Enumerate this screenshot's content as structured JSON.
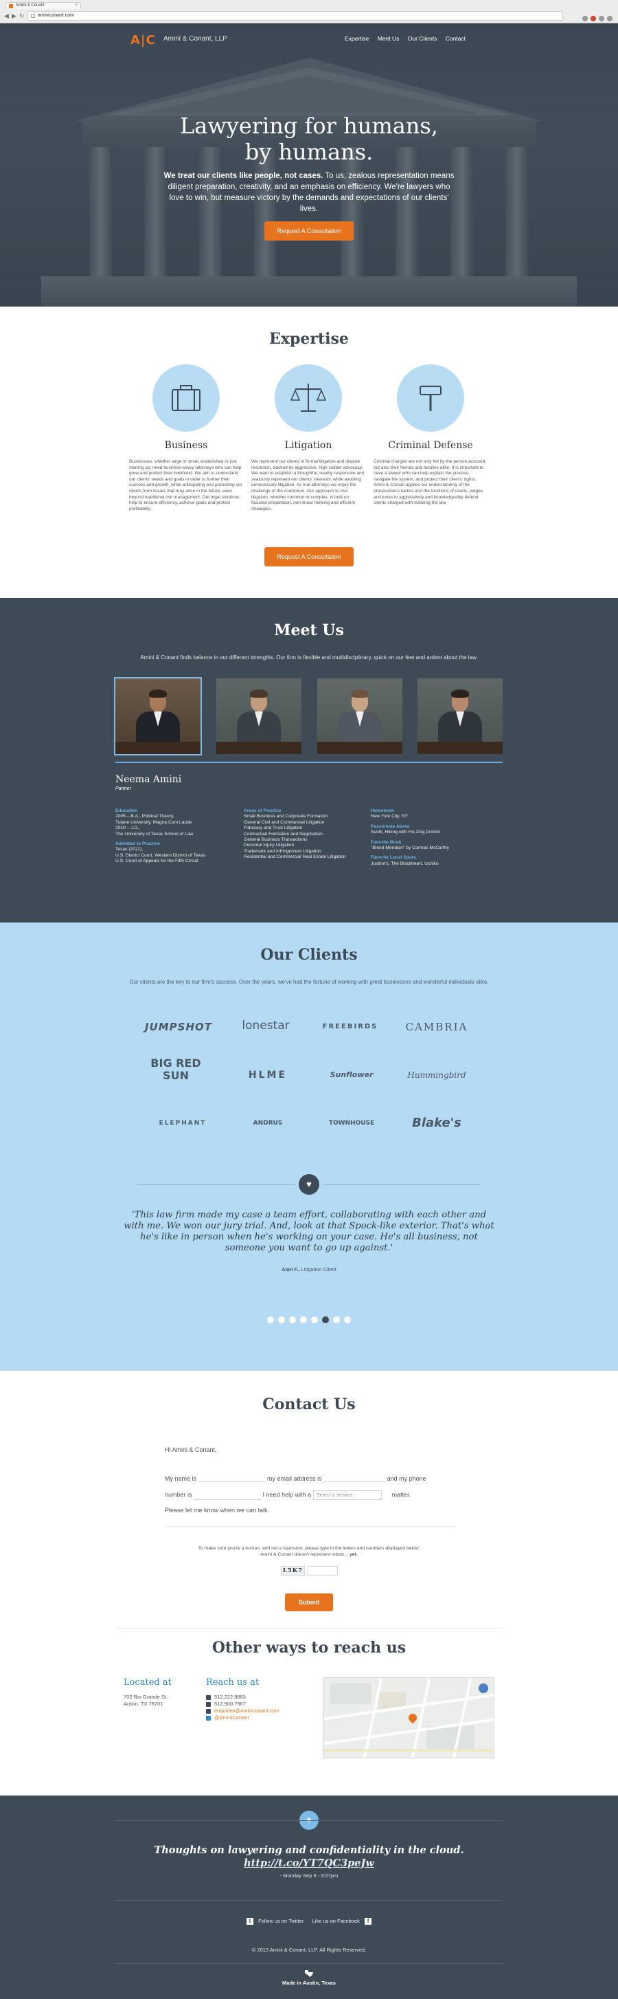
{
  "browser": {
    "tab_title": "Amini & Conant",
    "url": "aminiconant.com"
  },
  "header": {
    "logo": "A|C",
    "firm_name": "Amini & Conant, LLP",
    "nav": [
      "Expertise",
      "Meet Us",
      "Our Clients",
      "Contact"
    ]
  },
  "hero": {
    "title_line1": "Lawyering for humans,",
    "title_line2": "by humans.",
    "lede_bold": "We treat our clients like people, not cases.",
    "lede_rest": " To us, zealous representation means diligent preparation, creativity, and an emphasis on efficiency. We're lawyers who love to win, but measure victory by the demands and expectations of our clients' lives.",
    "cta": "Request A Consultation"
  },
  "expertise": {
    "title": "Expertise",
    "items": [
      {
        "icon": "briefcase-icon",
        "title": "Business",
        "text": "Businesses, whether large or small, established or just starting up, need business-savvy attorneys who can help grow and protect their livelihood. We aim to understand our clients' needs and goals in order to further their success and growth, while anticipating and protecting our clients from issues that may arise in the future, even beyond traditional risk management. Our legal solutions help to ensure efficiency, achieve goals and protect profitability."
      },
      {
        "icon": "scales-icon",
        "title": "Litigation",
        "text": "We represent our clients in formal litigation and dispute resolution, backed by aggressive, high-caliber advocacy. We want to establish a thoughtful, readily responsive and zealously represent our clients' interests, while avoiding unnecessary litigation. As trial attorneys we enjoy the challenge of the courtroom. Our approach to civil litigation, whether common or complex, is built on focused preparation, non-linear thinking and efficient strategies."
      },
      {
        "icon": "gavel-icon",
        "title": "Criminal Defense",
        "text": "Criminal charges are not only felt by the person accused, but also their friends and families alike. It is important to have a lawyer who can help explain the process, navigate the system, and protect their clients' rights. Amini & Conant applies our understanding of the prosecution's tactics and the functions of courts, judges and juries to aggressively and knowledgeably defend clients charged with violating the law."
      }
    ],
    "cta": "Request A Consultation"
  },
  "meet": {
    "title": "Meet Us",
    "intro": "Amini & Conant finds balance in our different strengths. Our firm is flexible and multidisciplinary, quick on our feet and ardent about the law.",
    "people_count_label": "4",
    "person": {
      "name": "Neema Amini",
      "role": "Partner",
      "col1": [
        {
          "h": "Education"
        },
        {
          "t": "2005 – B.A., Political Theory,"
        },
        {
          "t": "Tulane University, Magna Cum Laude"
        },
        {
          "t": "2010 – J.D.,"
        },
        {
          "t": "The University of Texas School of Law"
        },
        {
          "gap": true
        },
        {
          "h": "Admitted to Practice"
        },
        {
          "t": "Texas (2011),"
        },
        {
          "t": "U.S. District Court, Western District of Texas"
        },
        {
          "t": "U.S. Court of Appeals for the Fifth Circuit"
        }
      ],
      "col2": [
        {
          "h": "Areas of Practice"
        },
        {
          "t": "Small Business and Corporate Formation"
        },
        {
          "t": "General Civil and Commercial Litigation"
        },
        {
          "t": "Fiduciary and Trust Litigation"
        },
        {
          "t": "Contractual Formation and Negotiation"
        },
        {
          "t": "General Business Transactions"
        },
        {
          "t": "Personal Injury Litigation"
        },
        {
          "t": "Trademark and Infringement Litigation"
        },
        {
          "t": "Residential and Commercial Real Estate Litigation"
        }
      ],
      "col3": [
        {
          "h": "Hometown"
        },
        {
          "t": "New York City, NY"
        },
        {
          "gap": true
        },
        {
          "h": "Passionate About"
        },
        {
          "t": "Sushi, Hiking with His Dog Drinkin"
        },
        {
          "gap": true
        },
        {
          "h": "Favorite Book"
        },
        {
          "t": "\"Blood Meridian\" by Cormac McCarthy"
        },
        {
          "gap": true
        },
        {
          "h": "Favorite Local Spots"
        },
        {
          "t": "Justine's, The Blackheart, Uchiko"
        }
      ]
    }
  },
  "clients": {
    "title": "Our Clients",
    "intro": "Our clients are the key to our firm's success. Over the years, we've had the fortune of working with great businesses and wonderful individuals alike.",
    "logos": [
      "JUMPSHOT",
      "lonestar",
      "FREEBIRDS",
      "CAMBRIA",
      "BIG RED SUN",
      "HLME",
      "Sunflower",
      "Hummingbird",
      "ELEPHANT",
      "ANDRUS",
      "TOWNHOUSE",
      "Blake's"
    ],
    "quote": "'This law firm made my case a team effort, collaborating with each other and with me. We won our jury trial. And, look at that Spock-like exterior. That's what he's like in person when he's working on your case. He's all business, not someone you want to go up against.'",
    "cite_name": "Alan F.,",
    "cite_role": " Litigation Client",
    "slides": 8,
    "active_slide": 5
  },
  "contact": {
    "title": "Contact Us",
    "greeting": "Hi Amini & Conant,",
    "my_name_is": "My name is",
    "my_email_is": "my email address is",
    "and_my_phone": "and my phone",
    "number_is": "number is",
    "need_help": "I need help with a",
    "select_placeholder": "Select a service",
    "matter": "matter.",
    "closing": "Please let me know when we can talk.",
    "captcha_note1": "To make sure you're a human, and not a spam-bot, please type in the letters and numbers displayed below.",
    "captcha_note2": "Amini & Conant doesn't represent robots...",
    "captcha_note_bold": "yet.",
    "captcha_code": "L5K7",
    "submit": "Submit",
    "other_title": "Other ways to reach us",
    "located_h": "Located at",
    "address1": "702 Rio Grande St.",
    "address2": "Austin, TX 78701",
    "reach_h": "Reach us at",
    "phone": "512.222.8883",
    "fax": "512.900.7967",
    "email": "enquiries@aminiconant.com",
    "twitter": "@AminiConant"
  },
  "footer": {
    "tweet": "Thoughts on lawyering and confidentiality in the cloud.",
    "tweet_link": "http://t.co/YT7QC3peJw",
    "tweet_time": "- Monday Sep 9 - 3:07pm",
    "follow_twitter": "Follow us on Twitter",
    "like_facebook": "Like us on Facebook",
    "copyright": "© 2013 Amini & Conant, LLP. All Rights Reserved.",
    "made_in": "Made in Austin, Texas"
  },
  "colors": {
    "accent": "#e8731f",
    "dark": "#3e4a55",
    "light_blue": "#b5dbf4",
    "link_blue": "#2c88c7"
  }
}
